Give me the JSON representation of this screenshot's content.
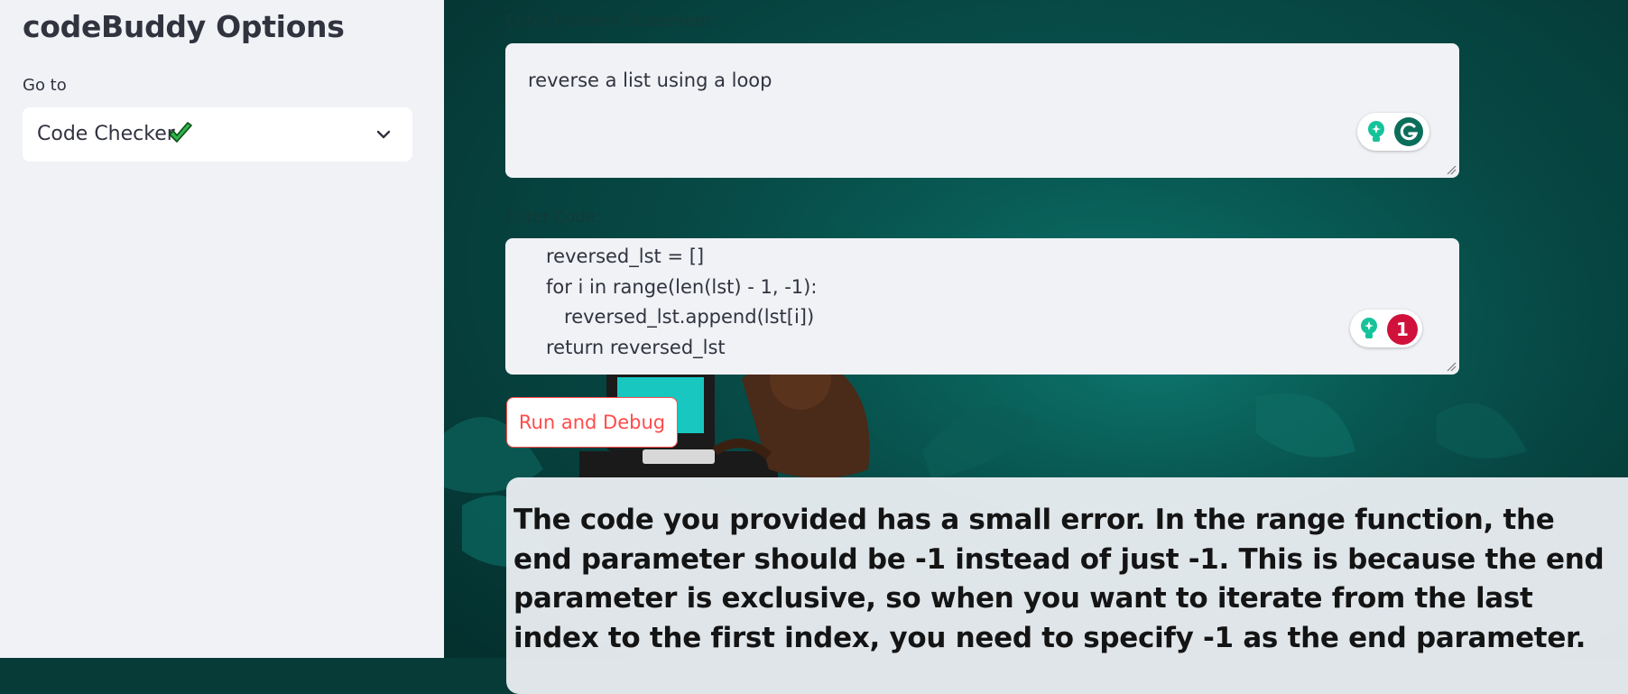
{
  "sidebar": {
    "title": "codeBuddy Options",
    "goto_label": "Go to",
    "select": {
      "value": "Code Checker",
      "icon": "check-mark-icon",
      "chevron": "chevron-down-icon"
    }
  },
  "main": {
    "problem": {
      "label": "Enter Problem Statement:",
      "value": "reverse a list using a loop"
    },
    "code": {
      "label": "Enter Code:",
      "lines": [
        "reversed_lst = []",
        "for i in range(len(lst) - 1, -1):",
        "   reversed_lst.append(lst[i])",
        "return reversed_lst"
      ]
    },
    "grammarly": {
      "problem_icons": [
        "lightbulb-icon",
        "grammarly-icon"
      ],
      "code_badge_count": "1"
    },
    "run_button": "Run and Debug",
    "result": "The code you provided has a small error. In the range function, the end parameter should be -1 instead of just -1. This is because the end parameter is exclusive, so when you want to iterate from the last index to the first index, you need to specify -1 as the end parameter."
  },
  "colors": {
    "sidebar_bg": "#f0f2f6",
    "accent": "#ff4b4b",
    "grammarly_green": "#15c39a",
    "badge_red": "#d0113b",
    "background": "#063b38"
  }
}
